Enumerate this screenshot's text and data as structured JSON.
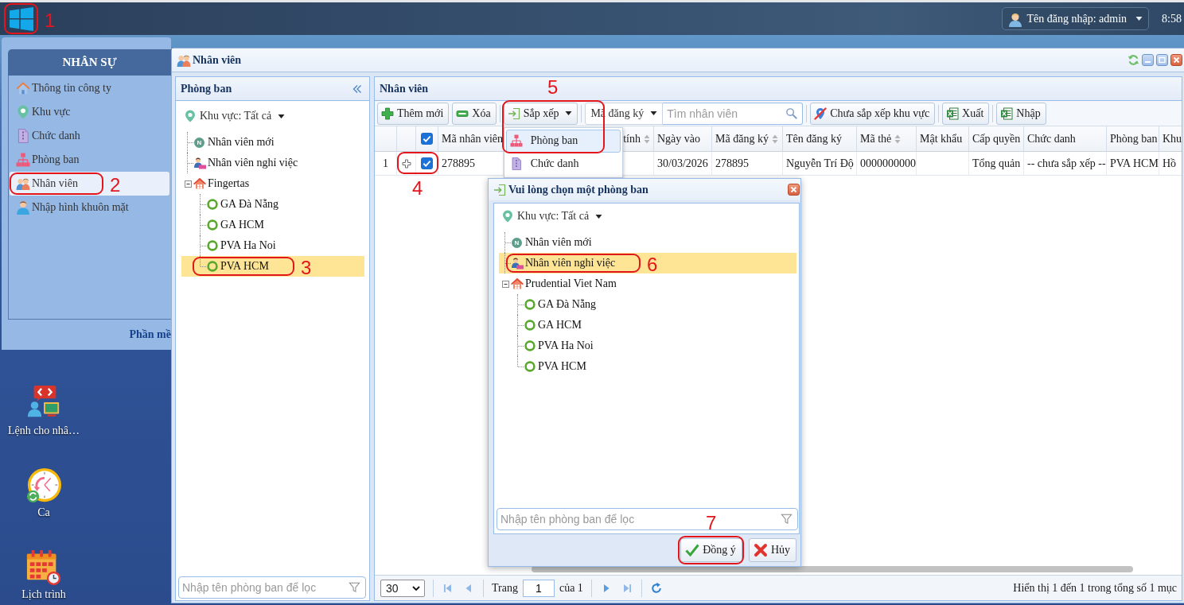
{
  "taskbar": {
    "start_button": {
      "callout": "1"
    },
    "user_menu": {
      "label": "Tên đăng nhập: admin"
    },
    "clock": "8:58"
  },
  "start_menu": {
    "title": "NHÂN SỰ",
    "items": [
      {
        "label": "Thông tin công ty",
        "kind": "company",
        "selected": false
      },
      {
        "label": "Khu vực",
        "kind": "area",
        "selected": false
      },
      {
        "label": "Chức danh",
        "kind": "title",
        "selected": false
      },
      {
        "label": "Phòng ban",
        "kind": "department",
        "selected": false
      },
      {
        "label": "Nhân viên",
        "kind": "employee",
        "selected": true,
        "callout": "2"
      },
      {
        "label": "Nhập hình khuôn mặt",
        "kind": "face",
        "selected": false
      }
    ],
    "footer": "Phần mề"
  },
  "desktop_shortcuts": [
    {
      "label": "Lệnh cho nhâ…",
      "kind": "command"
    },
    {
      "label": "Ca",
      "kind": "shift"
    },
    {
      "label": "Lịch trình",
      "kind": "schedule"
    }
  ],
  "window": {
    "title": "Nhân viên",
    "department_panel": {
      "title": "Phòng ban",
      "area_filter": "Khu vực: Tất cả",
      "tree": [
        {
          "label": "Nhân viên mới",
          "kind": "new",
          "badge": "N",
          "selected": false
        },
        {
          "label": "Nhân viên nghỉ việc",
          "kind": "resigned",
          "selected": false
        },
        {
          "label": "Fingertas",
          "kind": "company",
          "selected": false,
          "expanded": true,
          "children": [
            {
              "label": "GA Đà Nẵng",
              "kind": "branch",
              "selected": false
            },
            {
              "label": "GA HCM",
              "kind": "branch",
              "selected": false
            },
            {
              "label": "PVA Ha Noi",
              "kind": "branch",
              "selected": false
            },
            {
              "label": "PVA HCM",
              "kind": "branch",
              "selected": true,
              "callout": "3"
            }
          ]
        }
      ],
      "filter_placeholder": "Nhập tên phòng ban để lọc"
    },
    "employee_panel": {
      "title": "Nhân viên",
      "toolbar": [
        {
          "label": "Thêm mới",
          "kind": "add"
        },
        {
          "label": "Xóa",
          "kind": "delete"
        },
        {
          "label": "Sắp xếp",
          "kind": "sort",
          "open": true,
          "callout": "5",
          "menu": [
            {
              "label": "Phòng ban",
              "kind": "department",
              "selected": true
            },
            {
              "label": "Chức danh",
              "kind": "title",
              "selected": false
            }
          ]
        },
        {
          "kind": "search",
          "field_label": "Mã đăng ký",
          "placeholder": "Tìm nhân viên"
        },
        {
          "label": "Chưa sắp xếp khu vực",
          "kind": "unassigned"
        },
        {
          "label": "Xuất",
          "kind": "export"
        },
        {
          "label": "Nhập",
          "kind": "import"
        }
      ],
      "table": {
        "all_checked": true,
        "columns": [
          {
            "label": "Mã nhân viên",
            "sortable": false
          },
          {
            "label": "tính",
            "sortable": true
          },
          {
            "label": "Ngày vào",
            "sortable": false
          },
          {
            "label": "Mã đăng ký",
            "sortable": true
          },
          {
            "label": "Tên đăng ký",
            "sortable": false
          },
          {
            "label": "Mã thẻ",
            "sortable": true
          },
          {
            "label": "Mật khẩu",
            "sortable": false
          },
          {
            "label": "Cấp quyền",
            "sortable": false
          },
          {
            "label": "Chức danh",
            "sortable": false
          },
          {
            "label": "Phòng ban"
          },
          {
            "label": "Khu"
          }
        ],
        "rows": [
          {
            "index": "1",
            "expanded": false,
            "checked": true,
            "callout": "4",
            "cells": [
              "278895",
              null,
              "30/03/2026",
              "278895",
              "Nguyễn Trí Độ",
              "0000000000",
              null,
              "Tổng quản",
              "-- chưa sắp xếp --",
              "PVA HCM",
              "Hồ"
            ]
          }
        ]
      },
      "pager": {
        "page_size": "30",
        "page_label": "Trang",
        "page": "1",
        "page_count_label": "của 1",
        "summary": "Hiển thị 1 đến 1 trong tổng số 1 mục"
      }
    }
  },
  "dialog": {
    "title": "Vui lòng chọn một phòng ban",
    "area_filter": "Khu vực: Tất cả",
    "tree": [
      {
        "label": "Nhân viên mới",
        "kind": "new",
        "badge": "N",
        "selected": false
      },
      {
        "label": "Nhân viên nghỉ việc",
        "kind": "resigned",
        "selected": true,
        "callout": "6"
      },
      {
        "label": "Prudential Viet Nam",
        "kind": "company",
        "selected": false,
        "expanded": true,
        "children": [
          {
            "label": "GA Đà Nẵng",
            "kind": "branch",
            "selected": false
          },
          {
            "label": "GA HCM",
            "kind": "branch",
            "selected": false
          },
          {
            "label": "PVA Ha Noi",
            "kind": "branch",
            "selected": false
          },
          {
            "label": "PVA HCM",
            "kind": "branch",
            "selected": false
          }
        ]
      }
    ],
    "filter_placeholder": "Nhập tên phòng ban để lọc",
    "buttons": [
      {
        "label": "Đồng ý",
        "kind": "ok",
        "callout": "7"
      },
      {
        "label": "Hủy",
        "kind": "cancel"
      }
    ]
  }
}
